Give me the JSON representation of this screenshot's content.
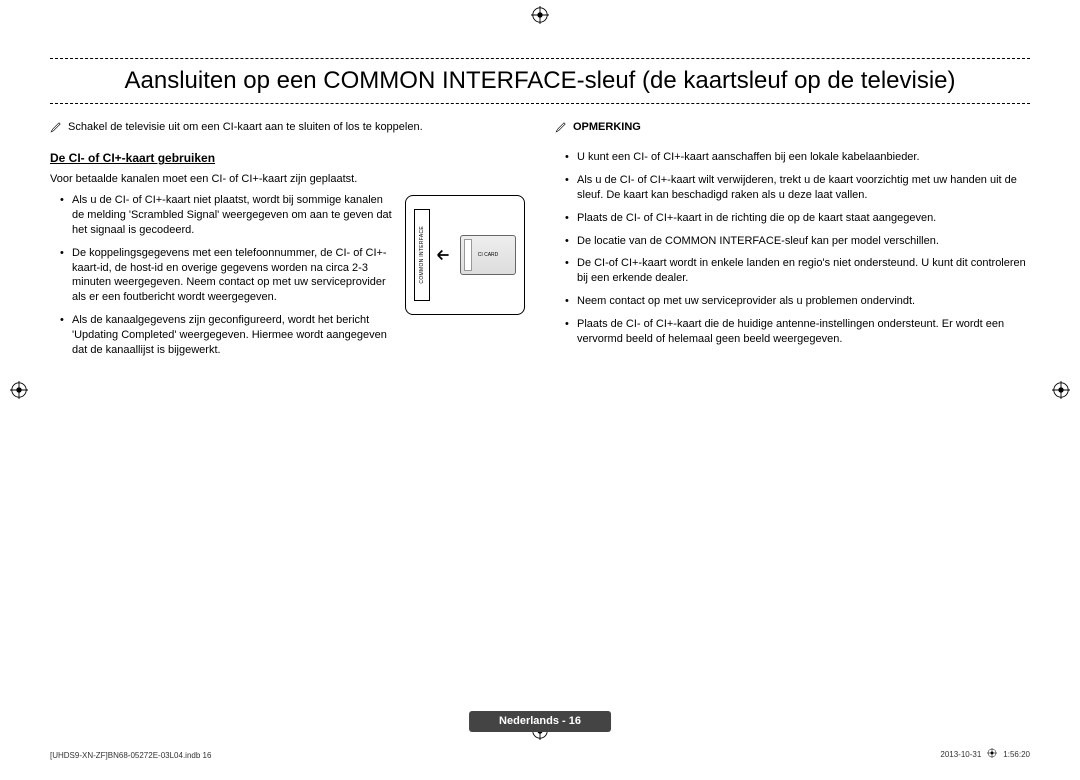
{
  "title": "Aansluiten op een COMMON INTERFACE-sleuf (de kaartsleuf op de televisie)",
  "top_note": "Schakel de televisie uit om een CI-kaart aan te sluiten of los te koppelen.",
  "heading_left": "De CI- of CI+-kaart gebruiken",
  "intro_left": "Voor betaalde kanalen moet een CI- of CI+-kaart zijn geplaatst.",
  "left_bullets": [
    "Als u de CI- of CI+-kaart niet plaatst, wordt bij sommige kanalen de melding 'Scrambled Signal' weergegeven om aan te geven dat het signaal is gecodeerd.",
    "De koppelingsgegevens met een telefoonnummer, de CI- of CI+-kaart-id, de host-id en overige gegevens worden na circa 2-3 minuten weergegeven. Neem contact op met uw serviceprovider als er een foutbericht wordt weergegeven.",
    "Als de kanaalgegevens zijn geconfigureerd, wordt het bericht 'Updating Completed' weergegeven. Hiermee wordt aangegeven dat de kanaallijst is bijgewerkt."
  ],
  "opmerking_label": "OPMERKING",
  "right_bullets": [
    "U kunt een CI- of CI+-kaart aanschaffen bij een lokale kabelaanbieder.",
    "Als u de CI- of CI+-kaart wilt verwijderen, trekt u de kaart voorzichtig met uw handen uit de sleuf. De kaart kan beschadigd raken als u deze laat vallen.",
    "Plaats de CI- of CI+-kaart in de richting die op de kaart staat aangegeven.",
    "De locatie van de COMMON INTERFACE-sleuf kan per model verschillen.",
    "De CI-of CI+-kaart wordt in enkele landen en regio's niet ondersteund. U kunt dit controleren bij een erkende dealer.",
    "Neem contact op met uw serviceprovider als u problemen ondervindt.",
    "Plaats de CI- of CI+-kaart die de huidige antenne-instellingen ondersteunt. Er wordt een vervormd beeld of helemaal geen beeld weergegeven."
  ],
  "slot_label": "COMMON INTERFACE",
  "card_label": "CI CARD",
  "page_badge": "Nederlands - 16",
  "footer_left": "[UHDS9-XN-ZF]BN68-05272E-03L04.indb   16",
  "footer_date": "2013-10-31",
  "footer_time": "1:56:20"
}
